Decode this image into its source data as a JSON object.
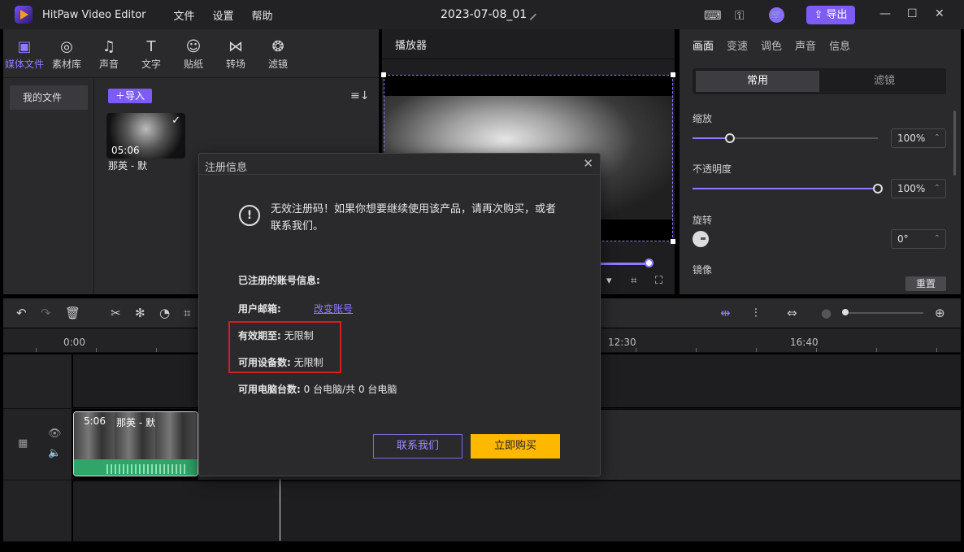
{
  "app": {
    "name": "HitPaw Video Editor",
    "menu": [
      "文件",
      "设置",
      "帮助"
    ],
    "project_title": "2023-07-08_01",
    "export_label": "导出"
  },
  "media_toolbar": [
    {
      "icon": "media-file-icon",
      "glyph": "▣",
      "label": "媒体文件",
      "active": true
    },
    {
      "icon": "globe-icon",
      "glyph": "◎",
      "label": "素材库"
    },
    {
      "icon": "music-note-icon",
      "glyph": "♫",
      "label": "声音"
    },
    {
      "icon": "text-icon",
      "glyph": "T",
      "label": "文字"
    },
    {
      "icon": "sticker-icon",
      "glyph": "☺",
      "label": "贴纸"
    },
    {
      "icon": "transition-icon",
      "glyph": "⋈",
      "label": "转场"
    },
    {
      "icon": "filter-icon",
      "glyph": "❂",
      "label": "滤镜"
    }
  ],
  "media": {
    "my_files": "我的文件",
    "import_label": "＋导入",
    "item": {
      "duration": "05:06",
      "name": "那英 - 默"
    }
  },
  "player": {
    "title": "播放器"
  },
  "properties": {
    "tabs": [
      "画面",
      "变速",
      "调色",
      "声音",
      "信息"
    ],
    "segment": [
      "常用",
      "滤镜"
    ],
    "scale_label": "缩放",
    "scale_value": "100%",
    "scale_fraction": 0.2,
    "opacity_label": "不透明度",
    "opacity_value": "100%",
    "opacity_fraction": 1.0,
    "rotate_label": "旋转",
    "rotate_value": "0°",
    "mirror_label": "镜像",
    "reset_label": "重置"
  },
  "timeline": {
    "ticks": [
      "0:00",
      "12:30",
      "16:40"
    ],
    "clip": {
      "duration": "5:06",
      "name": "那英 - 默"
    }
  },
  "dialog": {
    "title": "注册信息",
    "warning": "无效注册码！如果你想要继续使用该产品，请再次购买，或者联系我们。",
    "account_header": "已注册的账号信息:",
    "email_label": "用户邮箱:",
    "change_account": "改变账号",
    "valid_label": "有效期至:",
    "valid_value": "无限制",
    "devices_label": "可用设备数:",
    "devices_value": "无限制",
    "computers_label": "可用电脑台数:",
    "computers_value": "0 台电脑/共 0 台电脑",
    "contact_btn": "联系我们",
    "buy_btn": "立即购买"
  },
  "colors": {
    "accent": "#7c5cf5",
    "buy": "#ffb800",
    "highlight": "#d02020"
  }
}
